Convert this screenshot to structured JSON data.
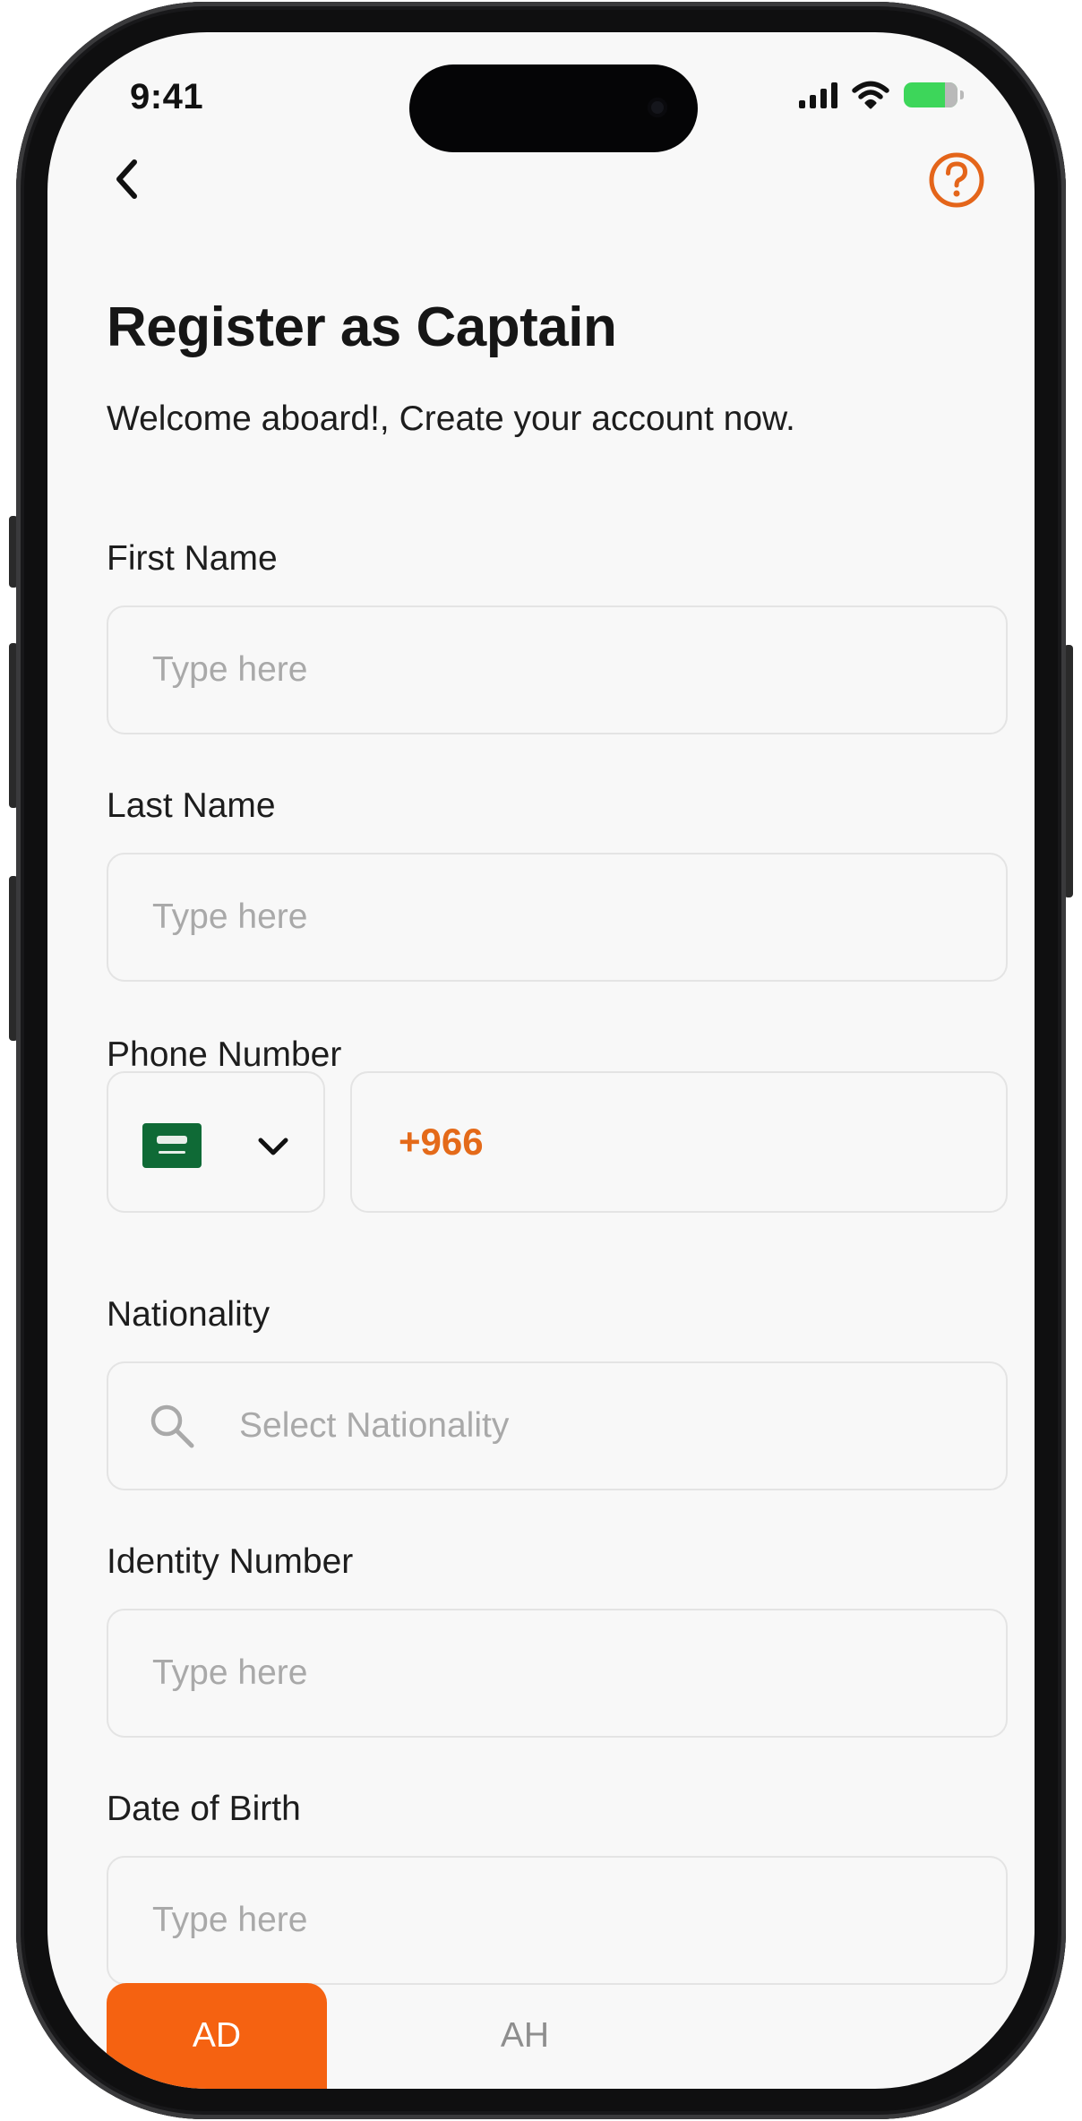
{
  "status_bar": {
    "time": "9:41",
    "battery_color": "#3dd65a"
  },
  "header": {
    "back_icon": "chevron-left-icon",
    "help_icon": "question-circle-icon",
    "accent_color": "#f56211"
  },
  "page": {
    "title": "Register as Captain",
    "subtitle": "Welcome aboard!, Create your account now."
  },
  "form": {
    "first_name": {
      "label": "First Name",
      "placeholder": "Type here",
      "value": ""
    },
    "last_name": {
      "label": "Last Name",
      "placeholder": "Type here",
      "value": ""
    },
    "phone": {
      "label": "Phone Number",
      "country_flag": "saudi-arabia-flag",
      "dial_code": "+966",
      "value": ""
    },
    "nationality": {
      "label": "Nationality",
      "placeholder": "Select Nationality",
      "value": ""
    },
    "identity_number": {
      "label": "Identity Number",
      "placeholder": "Type here",
      "value": ""
    },
    "date_of_birth": {
      "label": "Date of Birth",
      "placeholder": "Type here",
      "value": ""
    },
    "calendar_toggle": {
      "options": [
        "AD",
        "AH"
      ],
      "selected": "AD"
    }
  }
}
